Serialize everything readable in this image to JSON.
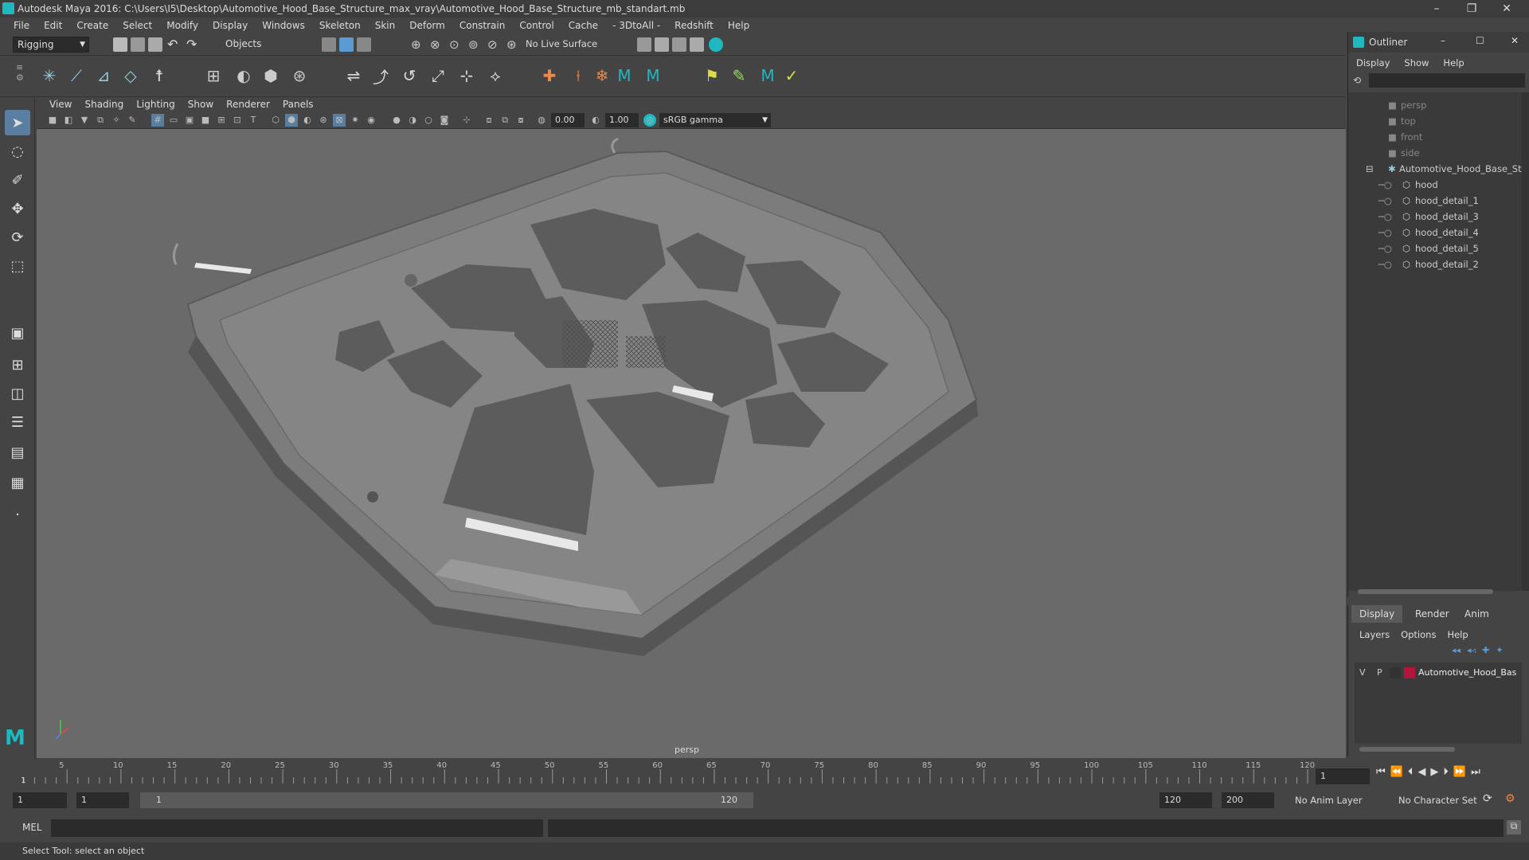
{
  "window": {
    "title": "Autodesk Maya 2016: C:\\Users\\I5\\Desktop\\Automotive_Hood_Base_Structure_max_vray\\Automotive_Hood_Base_Structure_mb_standart.mb",
    "min": "–",
    "max": "❐",
    "close": "✕"
  },
  "menubar": [
    "File",
    "Edit",
    "Create",
    "Select",
    "Modify",
    "Display",
    "Windows",
    "Skeleton",
    "Skin",
    "Deform",
    "Constrain",
    "Control",
    "Cache",
    "- 3DtoAll -",
    "Redshift",
    "Help"
  ],
  "statusline": {
    "mode": "Rigging",
    "select_mode": "Objects",
    "live_surface": "No Live Surface"
  },
  "viewport": {
    "menu": [
      "View",
      "Shading",
      "Lighting",
      "Show",
      "Renderer",
      "Panels"
    ],
    "exposure": "0.00",
    "gamma": "1.00",
    "colorspace": "sRGB gamma",
    "camera_label": "persp"
  },
  "timeslider": {
    "ticks": [
      "5",
      "10",
      "15",
      "20",
      "25",
      "30",
      "35",
      "40",
      "45",
      "50",
      "55",
      "60",
      "65",
      "70",
      "75",
      "80",
      "85",
      "90",
      "95",
      "100",
      "105",
      "110",
      "115",
      "120"
    ],
    "start_tick": "1",
    "current_frame": "1"
  },
  "range": {
    "start": "1",
    "playback_start": "1",
    "slider_start": "1",
    "slider_end": "120",
    "playback_end": "120",
    "end": "200",
    "anim_layer": "No Anim Layer",
    "character_set": "No Character Set"
  },
  "cmdline": {
    "label": "MEL"
  },
  "helpline": {
    "text": "Select Tool: select an object"
  },
  "outliner": {
    "title": "Outliner",
    "menu": [
      "Display",
      "Show",
      "Help"
    ],
    "cameras": [
      "persp",
      "top",
      "front",
      "side"
    ],
    "group": "Automotive_Hood_Base_Stru",
    "children": [
      "hood",
      "hood_detail_1",
      "hood_detail_3",
      "hood_detail_4",
      "hood_detail_5",
      "hood_detail_2"
    ]
  },
  "layers": {
    "tabs": [
      "Display",
      "Render",
      "Anim"
    ],
    "menu": [
      "Layers",
      "Options",
      "Help"
    ],
    "row": {
      "v": "V",
      "p": "P",
      "name": "Automotive_Hood_Bas",
      "color": "#b3163a"
    }
  },
  "colors": {
    "accent": "#5a9bd4",
    "maya_teal": "#1fb8c1"
  }
}
